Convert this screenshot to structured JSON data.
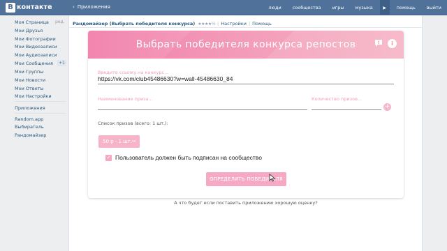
{
  "topbar": {
    "logo_letter": "В",
    "logo_text": "контакте",
    "back_label": "Приложения",
    "nav": [
      "люди",
      "сообщества",
      "игры",
      "музыка",
      "помощь",
      "выйти"
    ]
  },
  "sidebar": {
    "items": [
      "Моя Страница",
      "Мои Друзья",
      "Мои Фотографии",
      "Мои Видеозаписи",
      "Мои Аудиозаписи",
      "Мои Сообщения",
      "Мои Группы",
      "Мои Новости",
      "Мои Ответы",
      "Мои Настройки"
    ],
    "edit_label": "ред.",
    "messages_badge": "+1",
    "apps_label": "Приложения",
    "extra_items": [
      "Random.app",
      "Выбиратель",
      "Рандомайзер"
    ]
  },
  "app_header": {
    "title": "Рандомайзер (Выбрать победителя конкурса)",
    "stars": "★★★★½",
    "settings_link": "Настройки",
    "help_link": "Помощь"
  },
  "card": {
    "title": "Выбрать победителя конкурса репостов",
    "link_label": "Введите ссылку на конкурс...",
    "link_value": "https://vk.com/club45486630?w=wall-45486630_84",
    "prize_name_placeholder": "Наименование приза...",
    "prize_count_placeholder": "Количество призов...",
    "prize_list_label": "Список призов (всего: 1 шт.):",
    "prize_chip": "50 р - 1 шт.",
    "subscribe_checkbox_label": "Пользователь должен быть подписан на сообщество",
    "subscribe_checked": true,
    "action_button": "ОПРЕДЕЛИТЬ ПОБЕДИТЕЛЯ"
  },
  "footer_question": "А что будет если поставить приложению хорошую оценку?",
  "colors": {
    "topbar": "#50729a",
    "accent_pink": "#f17ba8",
    "link_blue": "#2b587a"
  }
}
